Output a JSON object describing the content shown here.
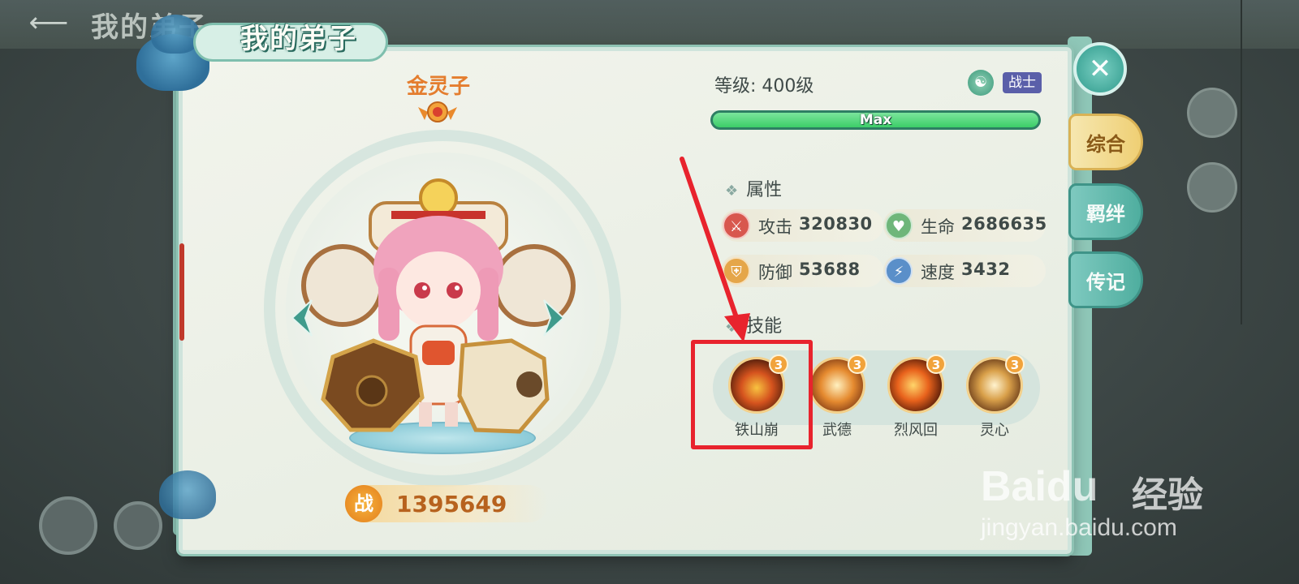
{
  "header": {
    "back_icon": "arrow-left-icon",
    "background_title": "我的弟子",
    "panel_title": "我的弟子"
  },
  "character": {
    "name": "金灵子",
    "power_icon_label": "战",
    "power": "1395649"
  },
  "info": {
    "level": "等级: 400级",
    "class": "战士",
    "exp_label": "Max",
    "exp_fraction": 1.0
  },
  "attributes": {
    "heading": "属性",
    "items": [
      {
        "label": "攻击",
        "value": "320830",
        "icon": "sword-icon",
        "color": "#d8574e"
      },
      {
        "label": "生命",
        "value": "2686635",
        "icon": "heart-icon",
        "color": "#6fb67a"
      },
      {
        "label": "防御",
        "value": "53688",
        "icon": "shield-icon",
        "color": "#e5a64a"
      },
      {
        "label": "速度",
        "value": "3432",
        "icon": "lightning-icon",
        "color": "#5a8fc9"
      }
    ]
  },
  "skills": {
    "heading": "技能",
    "items": [
      {
        "name": "铁山崩",
        "level": "3"
      },
      {
        "name": "武德",
        "level": "3"
      },
      {
        "name": "烈风回",
        "level": "3"
      },
      {
        "name": "灵心",
        "level": "3"
      }
    ]
  },
  "tabs": [
    {
      "label": "综合",
      "active": true
    },
    {
      "label": "羁绊",
      "active": false
    },
    {
      "label": "传记",
      "active": false
    }
  ],
  "watermark": {
    "brand": "Baidu",
    "suffix": "经验",
    "url": "jingyan.baidu.com"
  },
  "colors": {
    "accent_green": "#3ccd68",
    "annotation_red": "#e8232d",
    "name_orange": "#e47d2e",
    "class_badge": "#5a5fa9"
  }
}
